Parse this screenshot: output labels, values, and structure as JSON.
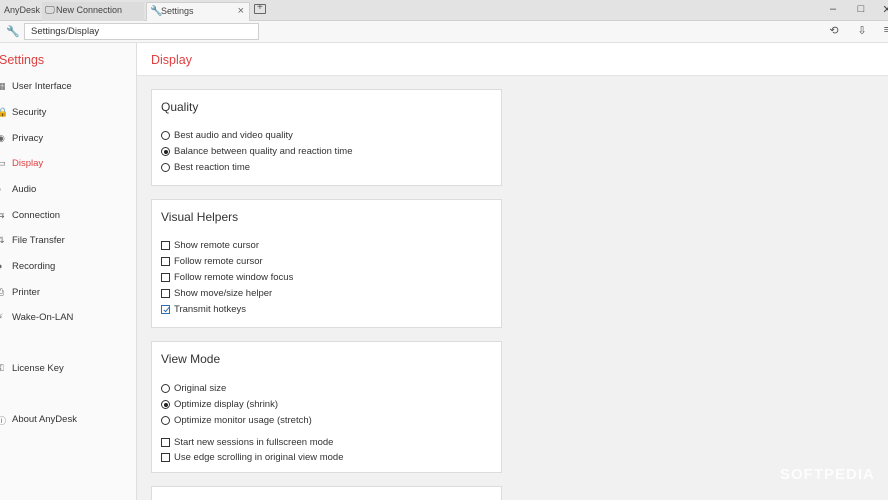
{
  "titlebar": {
    "brand": "AnyDesk",
    "tabs": [
      {
        "label": "New Connection",
        "icon": "monitor-icon"
      },
      {
        "label": "Settings",
        "icon": "wrench-icon",
        "close": "×"
      }
    ],
    "window_buttons": {
      "minimize": "–",
      "maximize": "□",
      "close": "✕"
    }
  },
  "addressbar": {
    "value": "Settings/Display"
  },
  "sidebar": {
    "title": "Settings",
    "items": [
      {
        "label": "User Interface",
        "icon": "▦"
      },
      {
        "label": "Security",
        "icon": "🔒"
      },
      {
        "label": "Privacy",
        "icon": "◉"
      },
      {
        "label": "Display",
        "icon": "▭"
      },
      {
        "label": "Audio",
        "icon": "♪"
      },
      {
        "label": "Connection",
        "icon": "⇆"
      },
      {
        "label": "File Transfer",
        "icon": "⇅"
      },
      {
        "label": "Recording",
        "icon": "●"
      },
      {
        "label": "Printer",
        "icon": "⎙"
      },
      {
        "label": "Wake-On-LAN",
        "icon": "⚡"
      },
      {
        "label": "License Key",
        "icon": "⚿"
      },
      {
        "label": "About AnyDesk",
        "icon": "ⓘ"
      }
    ]
  },
  "main": {
    "title": "Display",
    "quality": {
      "heading": "Quality",
      "options": [
        {
          "label": "Best audio and video quality",
          "selected": false
        },
        {
          "label": "Balance between quality and reaction time",
          "selected": true
        },
        {
          "label": "Best reaction time",
          "selected": false
        }
      ]
    },
    "visual_helpers": {
      "heading": "Visual Helpers",
      "options": [
        {
          "label": "Show remote cursor",
          "checked": false
        },
        {
          "label": "Follow remote cursor",
          "checked": false
        },
        {
          "label": "Follow remote window focus",
          "checked": false
        },
        {
          "label": "Show move/size helper",
          "checked": false
        },
        {
          "label": "Transmit hotkeys",
          "checked": true
        }
      ]
    },
    "view_mode": {
      "heading": "View Mode",
      "radios": [
        {
          "label": "Original size",
          "selected": false
        },
        {
          "label": "Optimize display (shrink)",
          "selected": true
        },
        {
          "label": "Optimize monitor usage (stretch)",
          "selected": false
        }
      ],
      "checks": [
        {
          "label": "Start new sessions in fullscreen mode",
          "checked": false
        },
        {
          "label": "Use edge scrolling in original view mode",
          "checked": false
        }
      ]
    }
  },
  "watermark": "SOFTPEDIA",
  "colors": {
    "accent": "#e04040",
    "check": "#2c6fb3"
  }
}
